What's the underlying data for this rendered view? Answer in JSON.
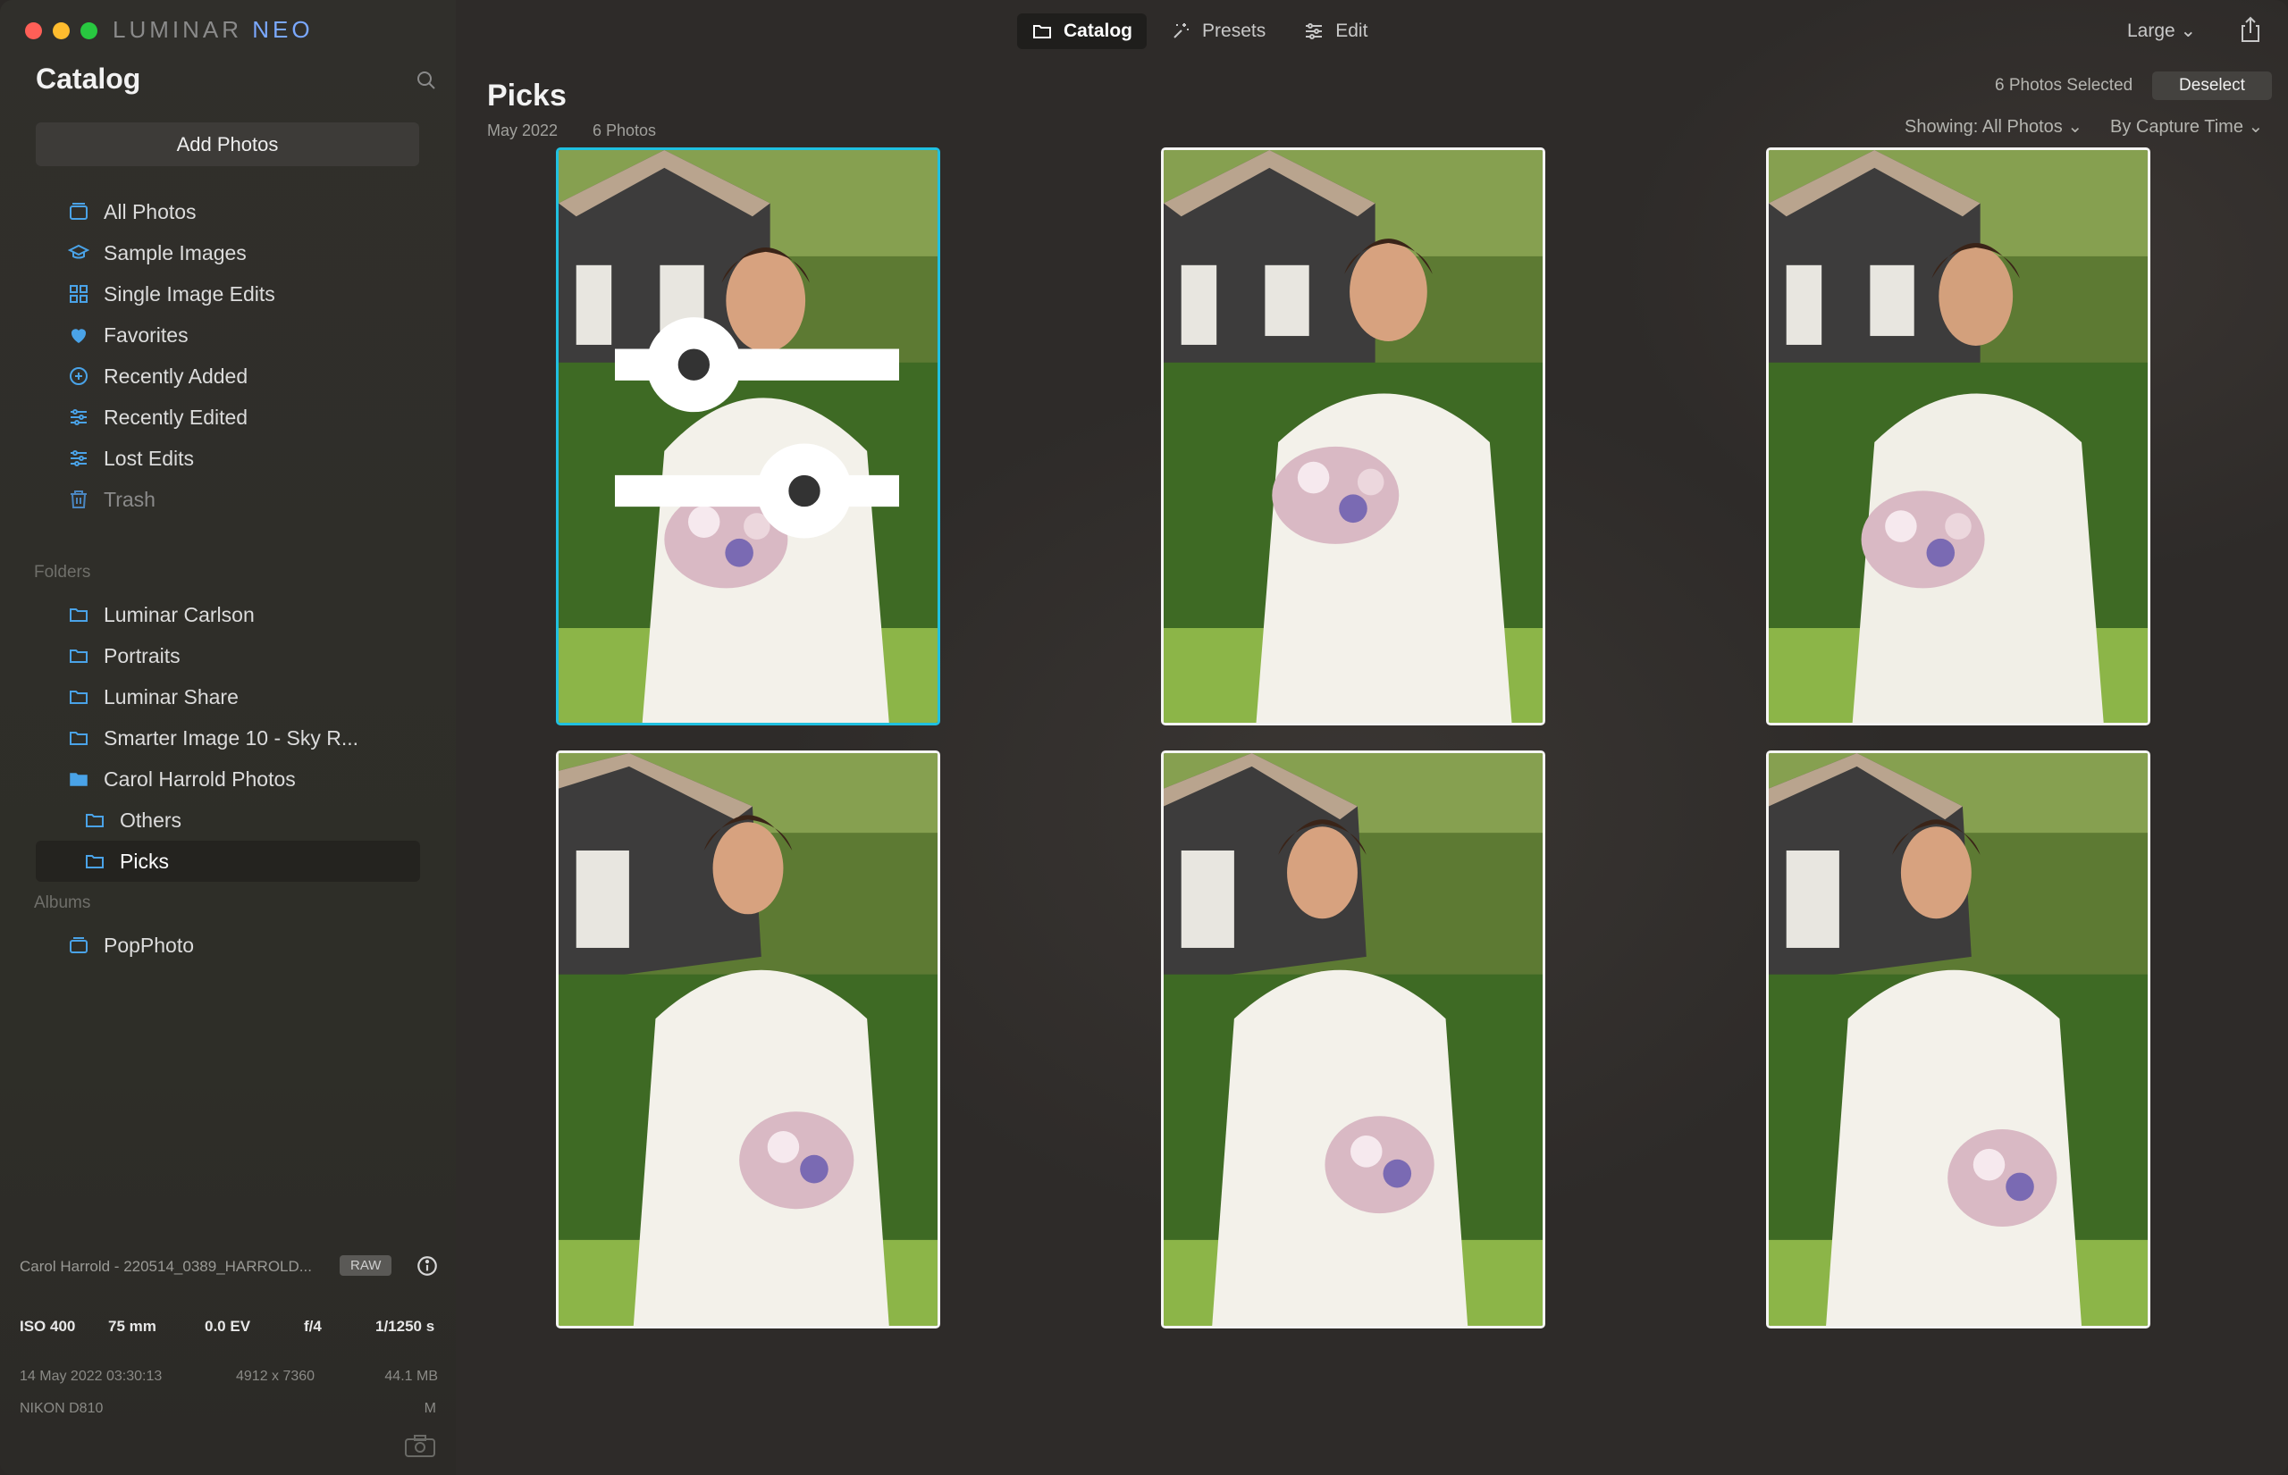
{
  "app": {
    "brand_main": "LUMINAR",
    "brand_neo": "NEO"
  },
  "toolbar": {
    "tabs": [
      {
        "label": "Catalog",
        "icon": "folder-icon",
        "active": true
      },
      {
        "label": "Presets",
        "icon": "sparkle-icon",
        "active": false
      },
      {
        "label": "Edit",
        "icon": "sliders-icon",
        "active": false
      }
    ],
    "size_label": "Large ⌄"
  },
  "sidebar": {
    "title": "Catalog",
    "add_photos": "Add Photos",
    "library": [
      {
        "label": "All Photos",
        "icon": "photos-icon"
      },
      {
        "label": "Sample Images",
        "icon": "graduation-cap-icon"
      },
      {
        "label": "Single Image Edits",
        "icon": "grid-icon"
      },
      {
        "label": "Favorites",
        "icon": "heart-icon"
      },
      {
        "label": "Recently Added",
        "icon": "plus-circle-icon"
      },
      {
        "label": "Recently Edited",
        "icon": "sliders-icon"
      },
      {
        "label": "Lost Edits",
        "icon": "sliders-icon"
      },
      {
        "label": "Trash",
        "icon": "trash-icon"
      }
    ],
    "folders_heading": "Folders",
    "folders": [
      {
        "label": "Luminar Carlson"
      },
      {
        "label": "Portraits"
      },
      {
        "label": "Luminar Share"
      },
      {
        "label": "Smarter Image 10 - Sky R..."
      },
      {
        "label": "Carol Harrold Photos"
      },
      {
        "label": "Others"
      },
      {
        "label": "Picks"
      }
    ],
    "albums_heading": "Albums",
    "albums": [
      {
        "label": "PopPhoto"
      }
    ]
  },
  "info": {
    "filename": "Carol Harrold - 220514_0389_HARROLD...",
    "format_badge": "RAW",
    "iso": "ISO 400",
    "focal": "75 mm",
    "ev": "0.0 EV",
    "aperture": "f/4",
    "shutter": "1/1250 s",
    "datetime": "14 May 2022 03:30:13",
    "dimensions": "4912 x 7360",
    "filesize": "44.1 MB",
    "camera": "NIKON D810",
    "mode": "M"
  },
  "main": {
    "title": "Picks",
    "date": "May 2022",
    "count": "6 Photos",
    "selected_count": "6 Photos Selected",
    "deselect": "Deselect",
    "showing": "Showing: All Photos ⌄",
    "sort": "By Capture Time ⌄"
  },
  "colors": {
    "accent": "#20c0e0",
    "folder_blue": "#4aa3e8"
  }
}
